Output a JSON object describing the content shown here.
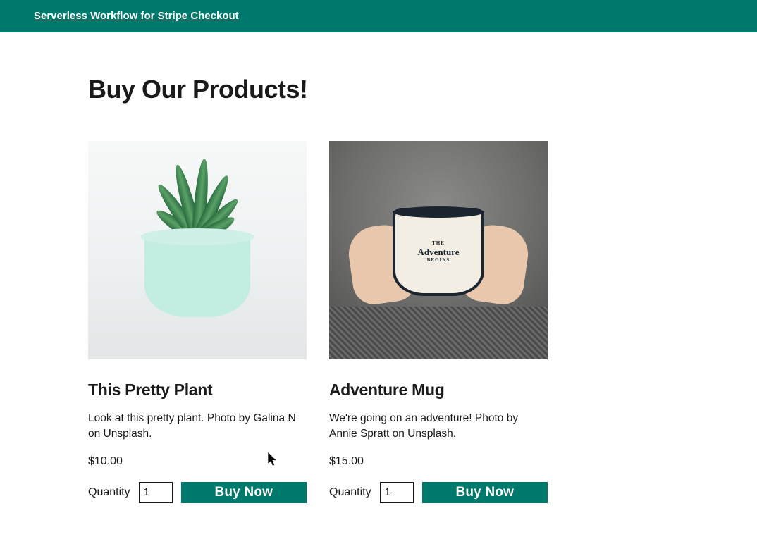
{
  "header": {
    "title_link": "Serverless Workflow for Stripe Checkout"
  },
  "page": {
    "heading": "Buy Our Products!"
  },
  "products": [
    {
      "title": "This Pretty Plant",
      "description": "Look at this pretty plant. Photo by Galina N on Unsplash.",
      "price": "$10.00",
      "quantity_label": "Quantity",
      "quantity_value": "1",
      "buy_label": "Buy Now"
    },
    {
      "title": "Adventure Mug",
      "description": "We're going on an adventure! Photo by Annie Spratt on Unsplash.",
      "price": "$15.00",
      "quantity_label": "Quantity",
      "quantity_value": "1",
      "buy_label": "Buy Now"
    }
  ],
  "mug_graphic": {
    "line1": "THE",
    "line2": "Adventure",
    "line3": "BEGINS"
  },
  "colors": {
    "brand": "#00796d"
  }
}
